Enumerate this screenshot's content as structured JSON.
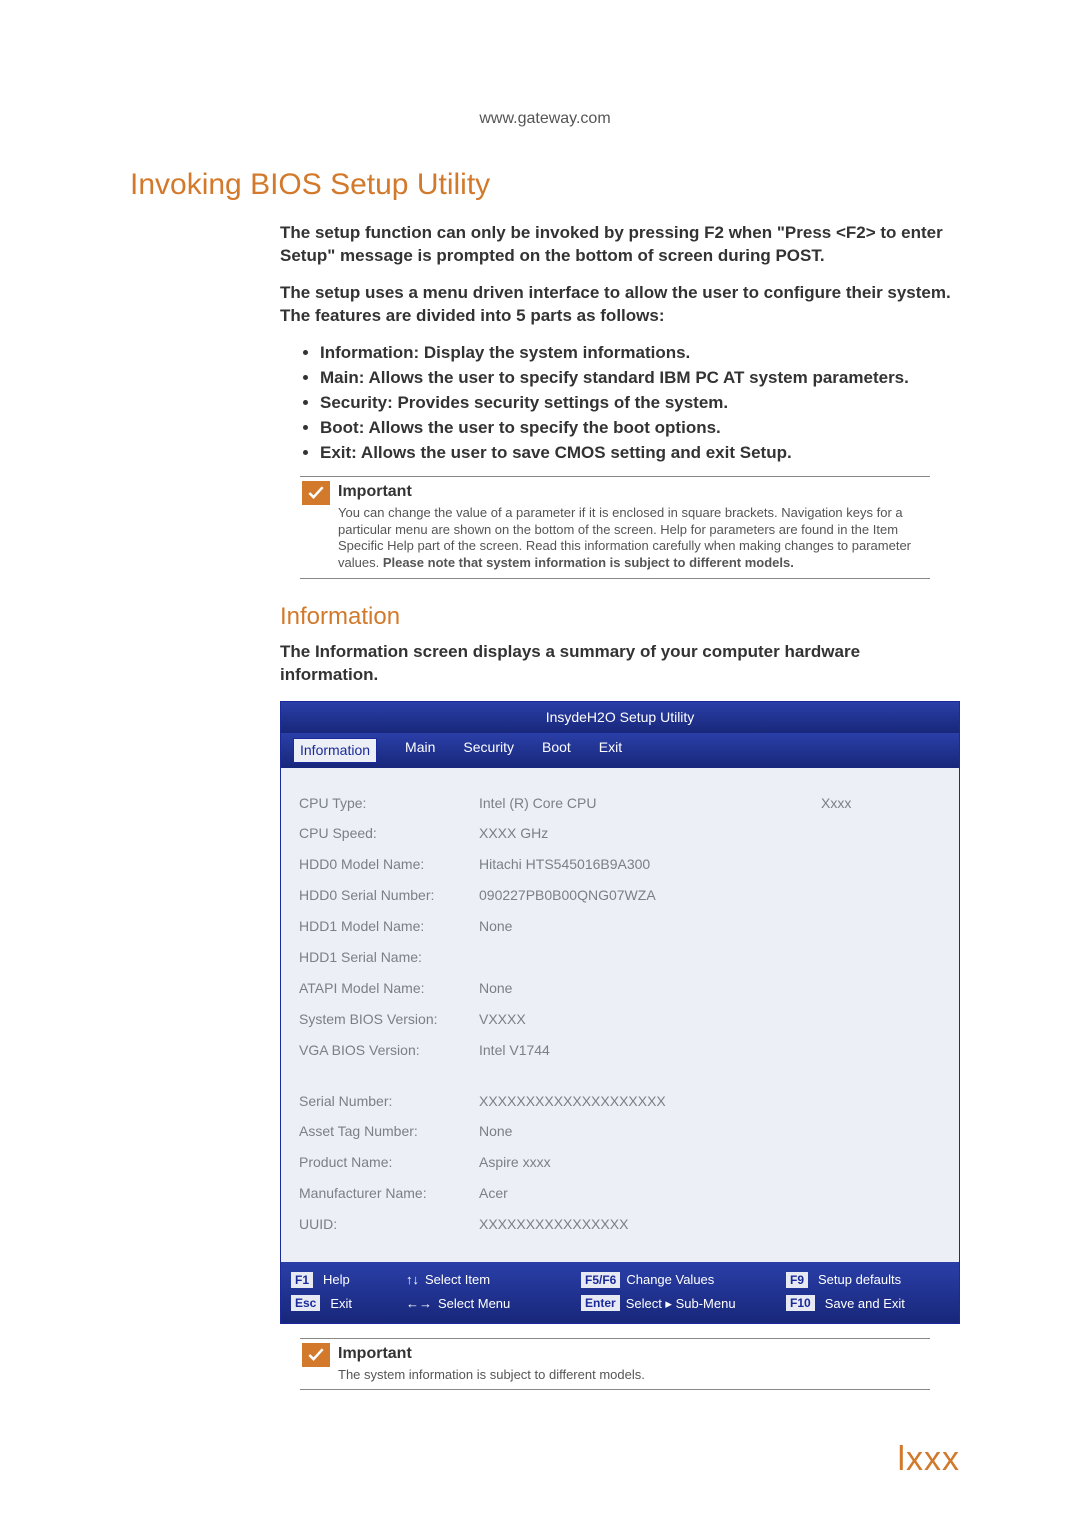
{
  "url_top": "www.gateway.com",
  "title": "Invoking BIOS Setup Utility",
  "para1_a": "The setup function can only be invoked by pressing ",
  "para1_b": "F2",
  "para1_c": " when \"Press ",
  "para1_d": "<F2>",
  "para1_e": " to enter Setup\" message is prompted on the bottom of screen during POST.",
  "para2": "The setup uses a menu driven interface to allow the user to configure their system. The features are divided into 5 parts as follows:",
  "bullets": [
    "Information: Display the system informations.",
    "Main: Allows the user to specify standard IBM PC AT system parameters.",
    "Security: Provides security settings of the system.",
    "Boot: Allows the user to specify the boot options.",
    "Exit: Allows the user to save CMOS setting and exit Setup."
  ],
  "note1_title": "Important",
  "note1_text_a": "You can change the value of a parameter if it is enclosed in square brackets. Navigation keys for a particular menu are shown on the bottom of the screen. Help for parameters are found in the Item Specific Help part of the screen. Read this information carefully when making changes to parameter values. ",
  "note1_text_b": "Please note that system information is subject to different models.",
  "info_heading": "Information",
  "info_para": "The Information screen displays a summary of your computer hardware information.",
  "bios": {
    "title": "InsydeH2O Setup Utility",
    "tabs": [
      "Information",
      "Main",
      "Security",
      "Boot",
      "Exit"
    ],
    "rows": [
      {
        "label": "CPU Type:",
        "value": "Intel (R) Core CPU",
        "extra": "Xxxx"
      },
      {
        "label": "CPU Speed:",
        "value": "XXXX GHz",
        "extra": ""
      },
      {
        "label": "HDD0 Model Name:",
        "value": "Hitachi HTS545016B9A300",
        "extra": ""
      },
      {
        "label": "HDD0 Serial Number:",
        "value": "090227PB0B00QNG07WZA",
        "extra": ""
      },
      {
        "label": "HDD1 Model Name:",
        "value": "None",
        "extra": ""
      },
      {
        "label": "HDD1 Serial Name:",
        "value": "",
        "extra": ""
      },
      {
        "label": "ATAPI Model Name:",
        "value": "None",
        "extra": ""
      },
      {
        "label": "System BIOS Version:",
        "value": "VXXXX",
        "extra": ""
      },
      {
        "label": "VGA BIOS Version:",
        "value": "Intel V1744",
        "extra": ""
      }
    ],
    "rows2": [
      {
        "label": "Serial Number:",
        "value": "XXXXXXXXXXXXXXXXXXXX"
      },
      {
        "label": "Asset Tag Number:",
        "value": "None"
      },
      {
        "label": "Product Name:",
        "value": "Aspire xxxx"
      },
      {
        "label": "Manufacturer Name:",
        "value": "Acer"
      },
      {
        "label": "UUID:",
        "value": "XXXXXXXXXXXXXXXX"
      }
    ],
    "footer": {
      "r1": {
        "k1": "F1",
        "t1": "Help",
        "a2": "↑↓",
        "t2": "Select Item",
        "k3": "F5/F6",
        "t3": "Change Values",
        "k4": "F9",
        "t4": "Setup defaults"
      },
      "r2": {
        "k1": "Esc",
        "t1": "Exit",
        "a2": "←→",
        "t2": "Select Menu",
        "k3": "Enter",
        "t3": "Select ▸ Sub-Menu",
        "k4": "F10",
        "t4": "Save and Exit"
      }
    }
  },
  "note2_title": "Important",
  "note2_text": "The system information is subject to different models.",
  "page_num": "lxxx"
}
